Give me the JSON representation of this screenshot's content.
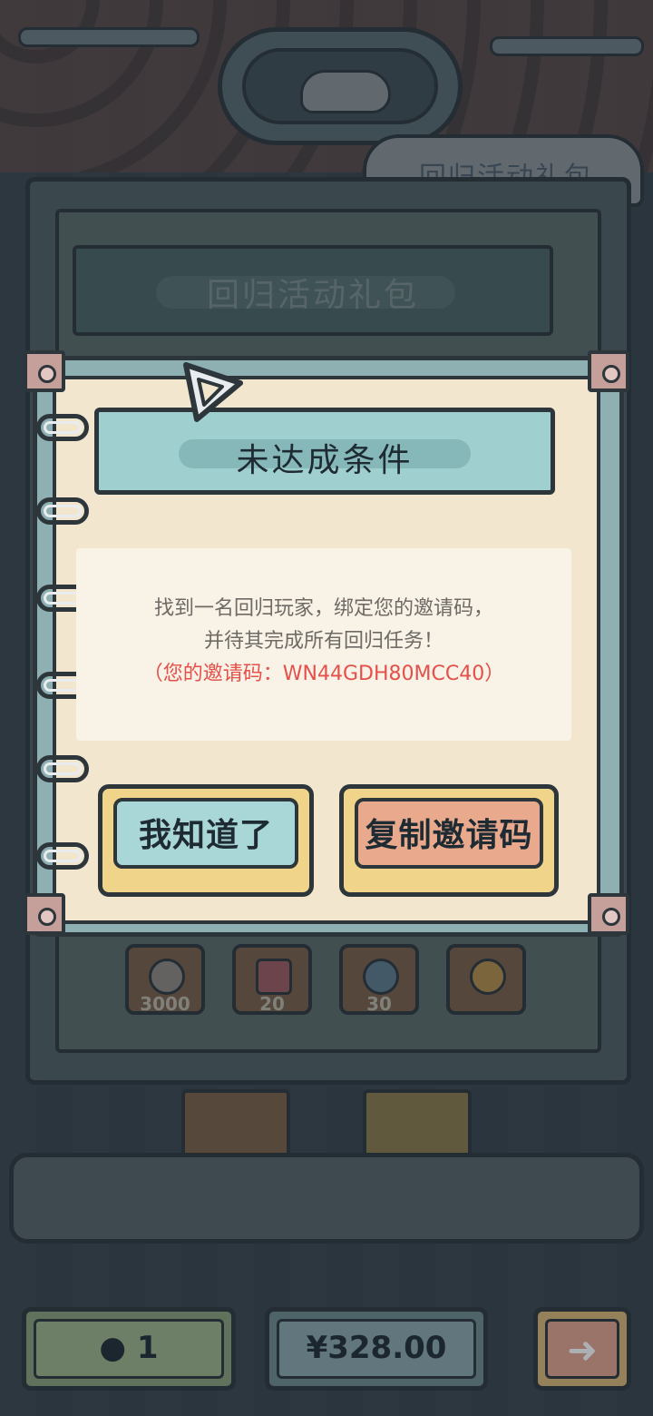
{
  "background": {
    "header_sign": "回归活动礼包",
    "panel_title": "回归活动礼包",
    "rewards": [
      {
        "count": "3000",
        "icon": "ghost-icon"
      },
      {
        "count": "20",
        "icon": "ticket-icon"
      },
      {
        "count": "30",
        "icon": "orb-icon"
      },
      {
        "count": "",
        "icon": "ring-icon"
      }
    ],
    "currency_count": "1",
    "price": "¥328.00",
    "next_icon": "arrow-right-icon"
  },
  "dialog": {
    "title": "未达成条件",
    "message_line1": "找到一名回归玩家，绑定您的邀请码，",
    "message_line2": "并待其完成所有回归任务！",
    "invite_line": "（您的邀请码：WN44GDH80MCC40）",
    "ok_button": "我知道了",
    "copy_button": "复制邀请码"
  },
  "colors": {
    "teal": "#9fcfcf",
    "ok_button_face": "#a9d7d8",
    "copy_button_face": "#e9a98c",
    "highlight_red": "#e4504a",
    "paper": "#f3e6cf"
  }
}
